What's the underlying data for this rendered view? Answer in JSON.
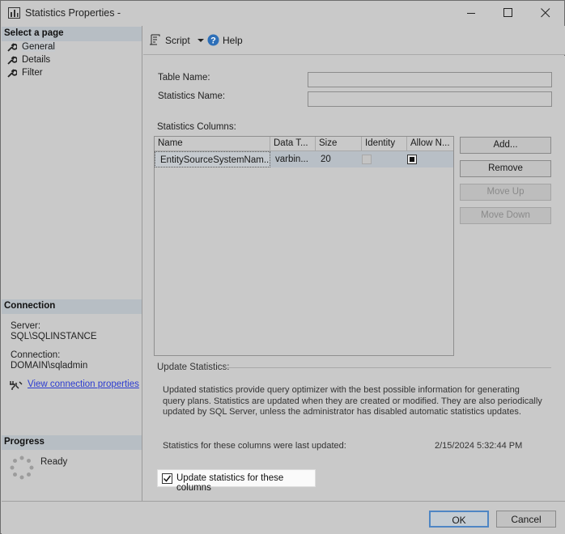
{
  "window": {
    "title": "Statistics Properties -"
  },
  "left": {
    "select_page_header": "Select a page",
    "pages": [
      {
        "label": "General",
        "icon": "wrench-icon"
      },
      {
        "label": "Details",
        "icon": "wrench-icon"
      },
      {
        "label": "Filter",
        "icon": "wrench-icon"
      }
    ],
    "connection_header": "Connection",
    "server_label": "Server:",
    "server_value": "SQL\\SQLINSTANCE",
    "connection_label": "Connection:",
    "connection_value": "DOMAIN\\sqladmin",
    "view_link": "View connection properties",
    "progress_header": "Progress",
    "progress_status": "Ready"
  },
  "toolbar": {
    "script_label": "Script",
    "help_label": "Help"
  },
  "form": {
    "table_name_label": "Table Name:",
    "table_name_value": "",
    "statistics_name_label": "Statistics Name:",
    "statistics_name_value": "",
    "statistics_columns_label": "Statistics Columns:"
  },
  "grid": {
    "columns": [
      "Name",
      "Data T...",
      "Size",
      "Identity",
      "Allow N..."
    ],
    "rows": [
      {
        "name": "EntitySourceSystemNam...",
        "data_type": "varbin...",
        "size": "20",
        "identity": false,
        "allow_nulls": true
      }
    ]
  },
  "buttons": {
    "add": "Add...",
    "remove": "Remove",
    "move_up": "Move Up",
    "move_down": "Move Down"
  },
  "update": {
    "group_label": "Update Statistics:",
    "description": "Updated statistics provide query optimizer with the best possible information for generating query plans. Statistics are updated when they are created or modified. They are also periodically updated by SQL Server, unless the administrator has disabled automatic statistics updates.",
    "last_updated_label": "Statistics for these columns were last updated:",
    "last_updated_value": "2/15/2024 5:32:44 PM",
    "checkbox_label": "Update statistics for these columns",
    "checkbox_checked": true
  },
  "dialog": {
    "ok": "OK",
    "cancel": "Cancel"
  }
}
